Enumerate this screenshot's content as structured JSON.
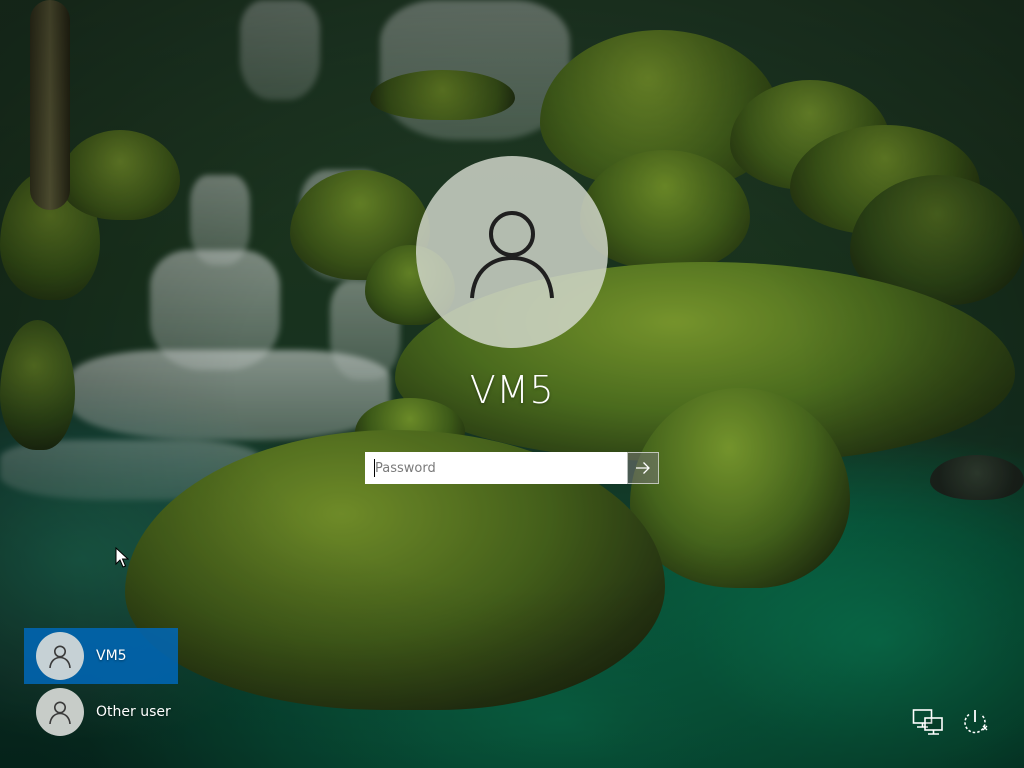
{
  "login": {
    "username": "VM5",
    "password_placeholder": "Password",
    "password_value": ""
  },
  "user_list": [
    {
      "label": "VM5",
      "selected": true
    },
    {
      "label": "Other user",
      "selected": false
    }
  ],
  "icons": {
    "avatar": "user-silhouette-icon",
    "submit": "arrow-right-icon",
    "network": "network-icon",
    "power": "power-icon",
    "pointer": "mouse-pointer-icon"
  },
  "colors": {
    "selected_tile": "#0067b8",
    "text": "#ffffff",
    "avatar_bg": "#d6dad0"
  }
}
